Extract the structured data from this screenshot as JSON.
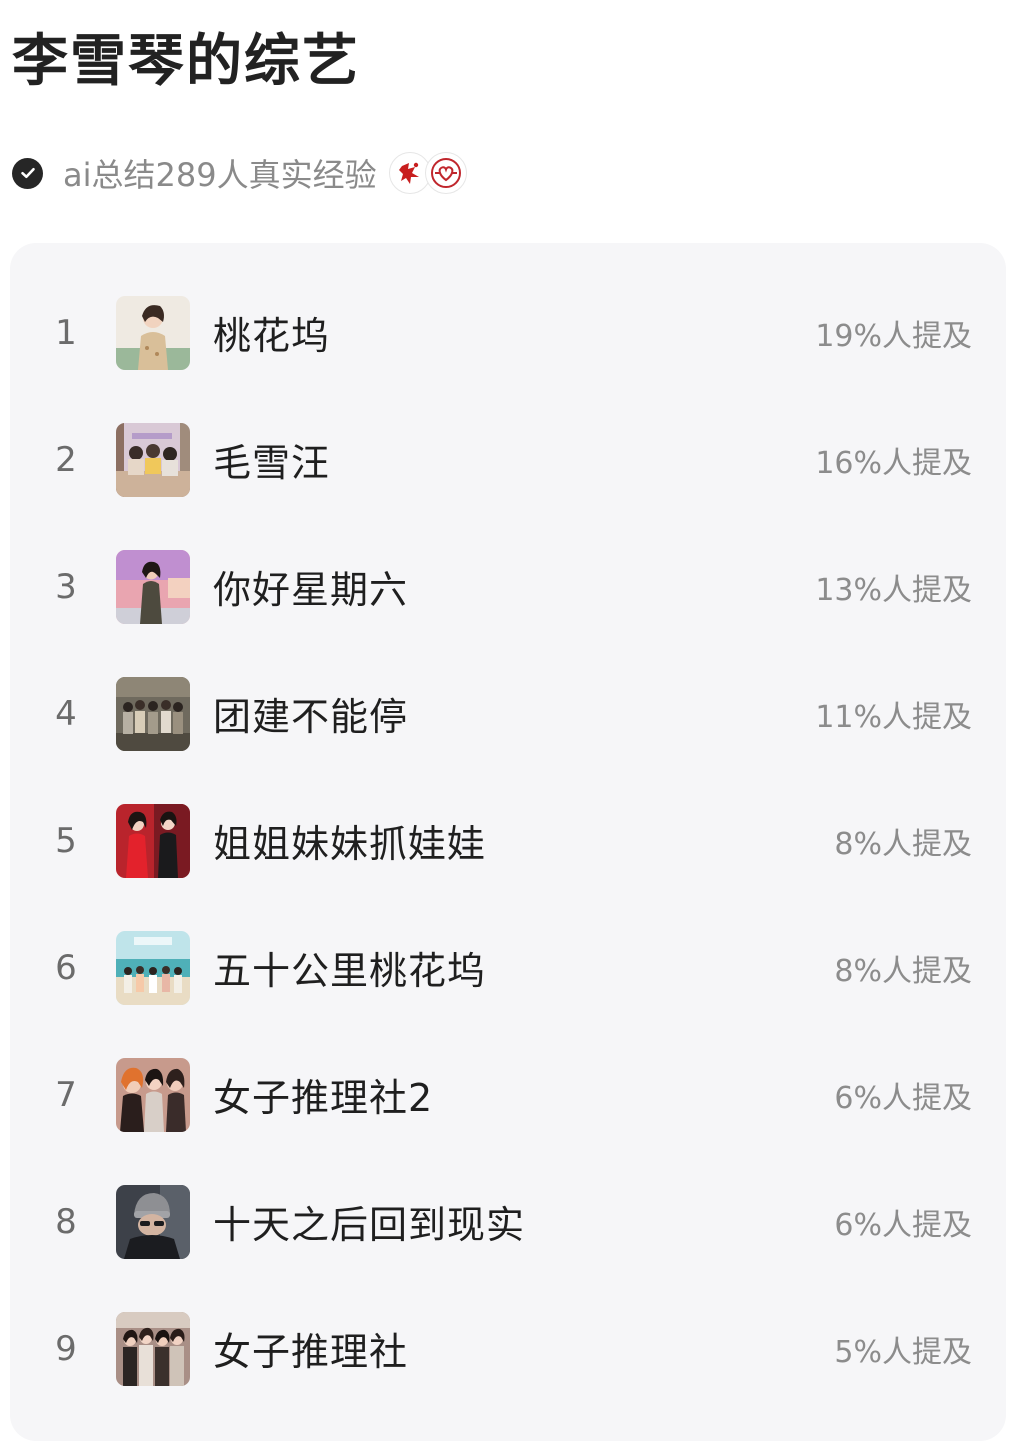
{
  "page": {
    "title": "李雪琴的综艺",
    "summary": "ai总结289人真实经验",
    "badges": [
      "red-star-badge-icon",
      "red-heart-badge-icon"
    ]
  },
  "colors": {
    "check_bg": "#262626",
    "card_bg": "#f6f6f8",
    "muted_text": "#8c8c8c"
  },
  "shows": [
    {
      "rank": "1",
      "name": "桃花坞",
      "mention": "19%人提及",
      "thumb": "portrait-woman-icon"
    },
    {
      "rank": "2",
      "name": "毛雪汪",
      "mention": "16%人提及",
      "thumb": "group-studio-icon"
    },
    {
      "rank": "3",
      "name": "你好星期六",
      "mention": "13%人提及",
      "thumb": "stage-host-icon"
    },
    {
      "rank": "4",
      "name": "团建不能停",
      "mention": "11%人提及",
      "thumb": "group-photo-icon"
    },
    {
      "rank": "5",
      "name": "姐姐妹妹抓娃娃",
      "mention": "8%人提及",
      "thumb": "red-dress-duo-icon"
    },
    {
      "rank": "6",
      "name": "五十公里桃花坞",
      "mention": "8%人提及",
      "thumb": "beach-group-icon"
    },
    {
      "rank": "7",
      "name": "女子推理社2",
      "mention": "6%人提及",
      "thumb": "three-women-icon"
    },
    {
      "rank": "8",
      "name": "十天之后回到现实",
      "mention": "6%人提及",
      "thumb": "beanie-man-icon"
    },
    {
      "rank": "9",
      "name": "女子推理社",
      "mention": "5%人提及",
      "thumb": "group-women-icon"
    }
  ]
}
